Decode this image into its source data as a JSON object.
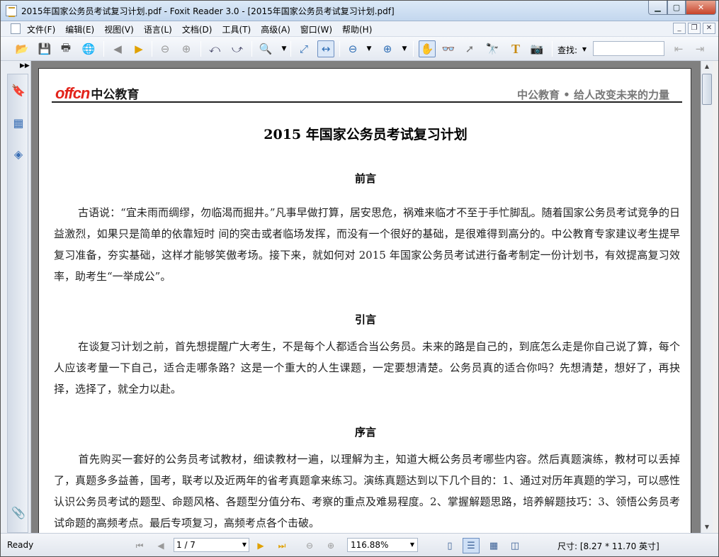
{
  "window": {
    "title": "2015年国家公务员考试复习计划.pdf - Foxit Reader 3.0 - [2015年国家公务员考试复习计划.pdf]"
  },
  "menu": [
    "文件(F)",
    "编辑(E)",
    "视图(V)",
    "语言(L)",
    "文档(D)",
    "工具(T)",
    "高级(A)",
    "窗口(W)",
    "帮助(H)"
  ],
  "toolbar": {
    "find_label": "查找:",
    "find_value": ""
  },
  "document": {
    "logo_en": "offcn",
    "logo_cn": "中公教育",
    "slogan": "中公教育 • 给人改变未来的力量",
    "title": "2015 年国家公务员考试复习计划",
    "sections": [
      {
        "heading": "前言",
        "text": "古语说：“宜未雨而绸缪，勿临渴而掘井。”凡事早做打算，居安思危，祸难来临才不至于手忙脚乱。随着国家公务员考试竞争的日益激烈，如果只是简单的依靠短时 间的突击或者临场发挥，而没有一个很好的基础，是很难得到高分的。中公教育专家建议考生提早复习准备，夯实基础，这样才能够笑傲考场。接下来，就如何对 2015 年国家公务员考试进行备考制定一份计划书，有效提高复习效率，助考生“一举成公”。"
      },
      {
        "heading": "引言",
        "text": "在谈复习计划之前，首先想提醒广大考生，不是每个人都适合当公务员。未来的路是自己的，到底怎么走是你自己说了算，每个人应该考量一下自己，适合走哪条路？这是一个重大的人生课题，一定要想清楚。公务员真的适合你吗？先想清楚，想好了，再抉择，选择了，就全力以赴。"
      },
      {
        "heading": "序言",
        "text": "首先购买一套好的公务员考试教材，细读教材一遍，以理解为主，知道大概公务员考哪些内容。然后真题演练，教材可以丢掉了，真题多多益善，国考，联考以及近两年的省考真题拿来练习。演练真题达到以下几个目的：1、通过对历年真题的学习，可以感性认识公务员考试的题型、命题风格、各题型分值分布、考察的重点及难易程度。2、掌握解题思路，培养解题技巧：3、领悟公务员考试命题的高频考点。最后专项复习，高频考点各个击破。"
      }
    ]
  },
  "status": {
    "ready": "Ready",
    "page": "1 / 7",
    "zoom": "116.88%",
    "size": "尺寸: [8.27 * 11.70 英寸]"
  }
}
